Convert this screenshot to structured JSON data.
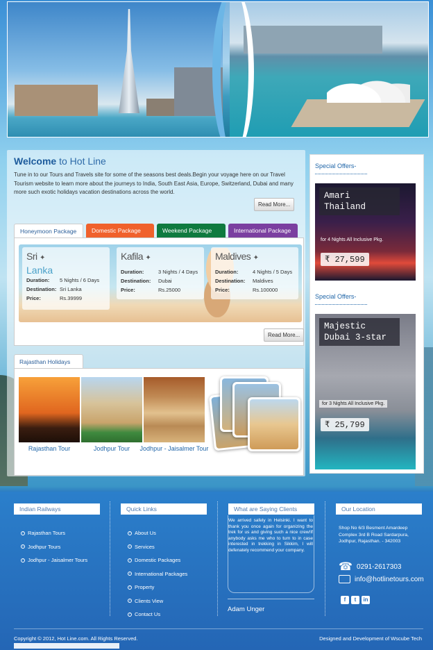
{
  "welcome": {
    "title_bold": "Welcome",
    "title_rest": " to Hot Line",
    "text": "Tune in to our Tours and Travels site for some of the seasons best deals.Begin your voyage here on our Travel Tourism website to learn more about the journeys to India, South East Asia, Europe, Switzerland, Dubai and many more such exotic holidays vacation destinations across the world.",
    "read_more": "Read More..."
  },
  "tabs": [
    "Honeymoon Package",
    "Domestic Package",
    "Weekend Package",
    "International Package"
  ],
  "packages": [
    {
      "name_line1": "Sri",
      "name_line2": "Lanka",
      "duration": "5 Nights / 6 Days",
      "destination": "Sri Lanka",
      "price": "Rs.39999"
    },
    {
      "name_line1": "Kafila",
      "name_line2": "",
      "duration": "3 Nights / 4 Days",
      "destination": "Dubai",
      "price": "Rs.25000"
    },
    {
      "name_line1": "Maldives",
      "name_line2": "",
      "duration": "4 Nights / 5 Days",
      "destination": "Maldives",
      "price": "Rs.100000"
    }
  ],
  "labels": {
    "duration": "Duration:",
    "destination": "Destination:",
    "price": "Price:"
  },
  "packages_read_more": "Read More...",
  "rajasthan": {
    "tab": "Rajasthan Holidays",
    "tours": [
      "Rajasthan Tour",
      "Jodhpur Tour",
      "Jodhpur - Jaisalmer Tour"
    ]
  },
  "offers": [
    {
      "title": "Special Offers-",
      "name_line1": "Amari",
      "name_line2": "Thailand",
      "sub": "for 4 Nights All Inclusive Pkg.",
      "price": "27,599"
    },
    {
      "title": "Special Offers-",
      "name_line1": "Majestic",
      "name_line2": "Dubai 3-star",
      "sub": "for 3 Nights All Inclusive Pkg.",
      "price": "25,799"
    }
  ],
  "currency_symbol": "₹",
  "footer": {
    "railways_title": "Indian Railways",
    "railways": [
      "Rajasthan Tours",
      "Jodhpur Tours",
      "Jodhpur - Jaisalmer Tours"
    ],
    "quick_title": "Quick Links",
    "quick": [
      "About Us",
      "Services",
      "Domestic Packages",
      "International Packages",
      "Property",
      "Clients View",
      "Contact Us"
    ],
    "clients_title": "What are Saying Clients",
    "testimonial": "We arrived safely in Helsinki. I want to thank you once again for organizing the trek for us and giving such a nice crew!If anybody asks me who to turn to in case interested in trekking in Sikkim, I will defenately recommend your company.",
    "author": "Adam Unger",
    "location_title": "Our Location",
    "address": "Shop No 6/3 Besment Amardeep Complex 3rd B Road Sardarpura, Jodhpur, Rajasthan. - 342003",
    "phone": "0291-2617303",
    "email": "info@hotlinetours.com",
    "social": [
      "f",
      "t",
      "in"
    ],
    "copyright": "Copyright © 2012, Hot Line.com. All Rights Reserved.",
    "designed": "Designed and Development of Wscube Tech"
  },
  "colors": {
    "link_blue": "#1f65a8",
    "tab_orange": "#f0612c",
    "tab_green": "#0f7a3f",
    "tab_purple": "#7b3fa0",
    "footer_blue": "#2a6fbf"
  }
}
